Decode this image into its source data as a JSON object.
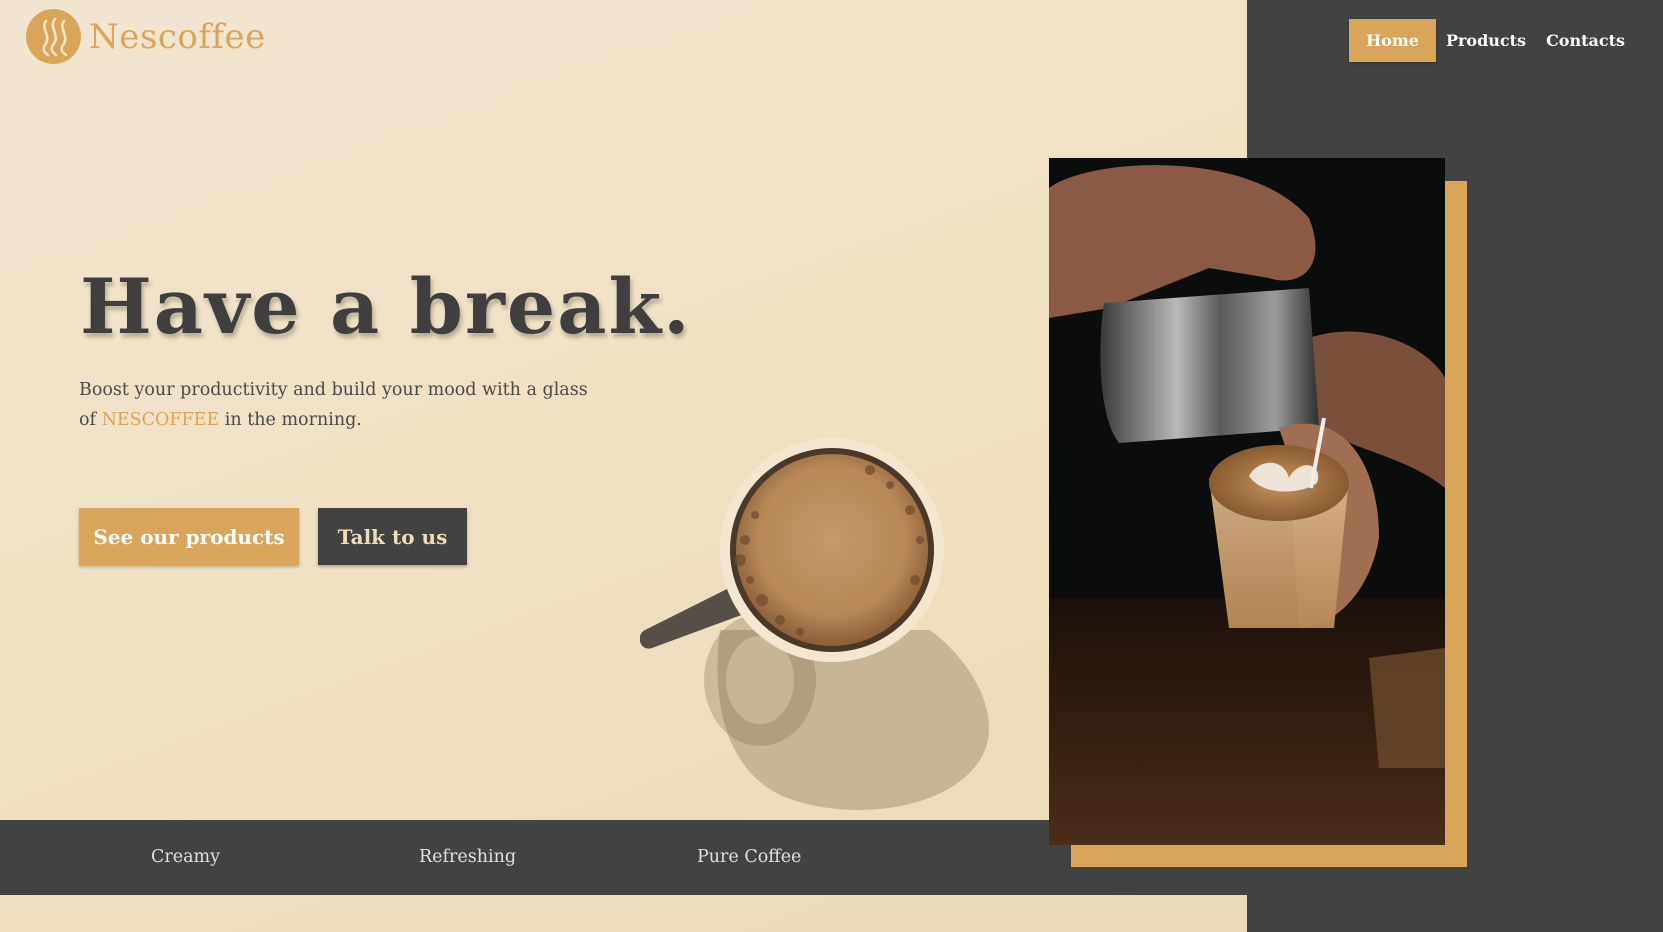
{
  "brand": {
    "name": "Nescoffee",
    "logo_icon": "steam-icon"
  },
  "nav": {
    "items": [
      {
        "label": "Home",
        "active": true
      },
      {
        "label": "Products",
        "active": false
      },
      {
        "label": "Contacts",
        "active": false
      }
    ]
  },
  "hero": {
    "title": "Have a break.",
    "description_before": "Boost your productivity and build your mood with a glass of ",
    "description_highlight": "NESCOFFEE",
    "description_after": " in the morning.",
    "primary_button": "See our products",
    "secondary_button": "Talk to us"
  },
  "features": [
    "Creamy",
    "Refreshing",
    "Pure Coffee"
  ],
  "images": {
    "background": "coffee-cup-illustration",
    "hero_photo": "latte-art-pour-photo"
  },
  "colors": {
    "accent": "#d8a55a",
    "dark": "#424242",
    "cream": "#f2e6d1",
    "text": "#3f3f3f"
  }
}
